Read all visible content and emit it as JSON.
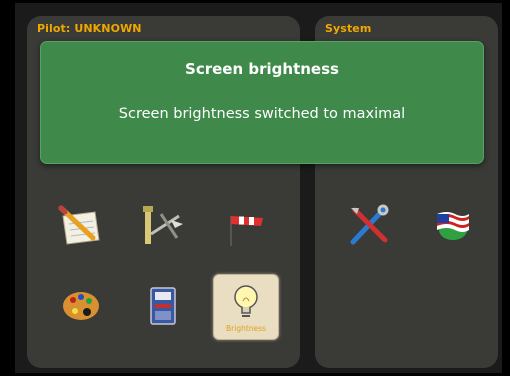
{
  "left_panel": {
    "title": "Pilot: UNKNOWN"
  },
  "right_panel": {
    "title": "System"
  },
  "toast": {
    "title": "Screen brightness",
    "message": "Screen brightness switched to maximal"
  },
  "tiles": {
    "brightness_label": "Brightness"
  },
  "icons": [
    "notepad-pencil-icon",
    "glider-icon",
    "windsock-icon",
    "palette-icon",
    "calculator-icon",
    "lightbulb-icon",
    "tools-icon",
    "language-flag-icon"
  ],
  "colors": {
    "title_accent": "#f0a800",
    "toast_bg": "#3f8a4b",
    "panel_bg": "#3a3a37",
    "selected_tile_bg": "#e9dec2"
  }
}
